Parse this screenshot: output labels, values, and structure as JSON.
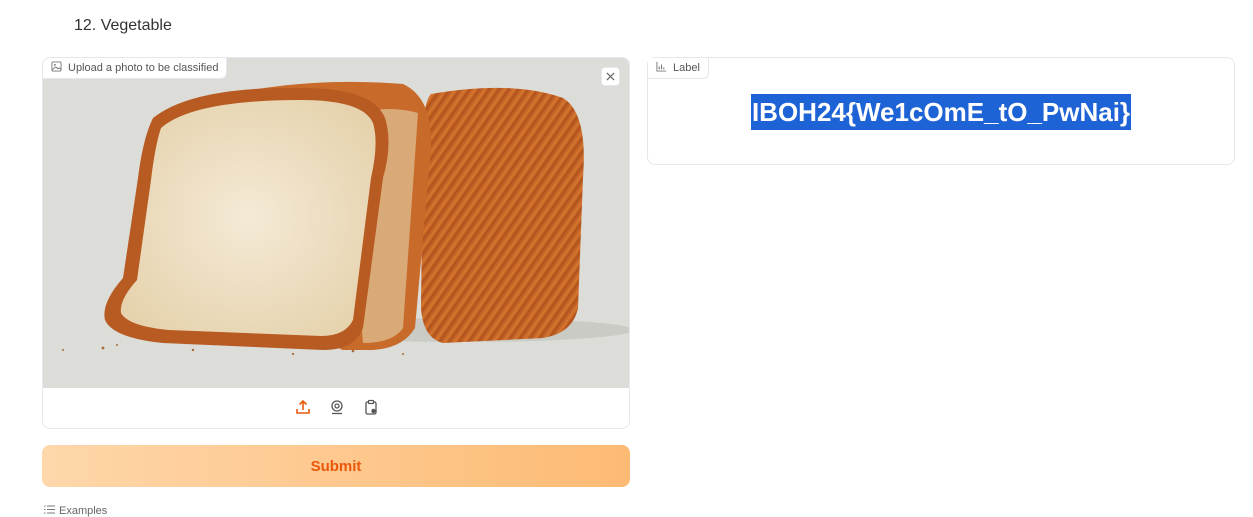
{
  "heading": "12. Vegetable",
  "image_input": {
    "label": "Upload a photo to be classified",
    "icons": [
      "image-icon",
      "close-icon",
      "upload-icon",
      "webcam-icon",
      "clipboard-icon"
    ]
  },
  "submit_label": "Submit",
  "examples_label": "Examples",
  "output": {
    "label": "Label",
    "value": "IBOH24{We1cOmE_tO_PwNai}"
  },
  "colors": {
    "accent": "#ea580c",
    "submit_gradient_start": "#fed7aa",
    "submit_gradient_end": "#fdba74",
    "highlight": "#1e63d6"
  }
}
